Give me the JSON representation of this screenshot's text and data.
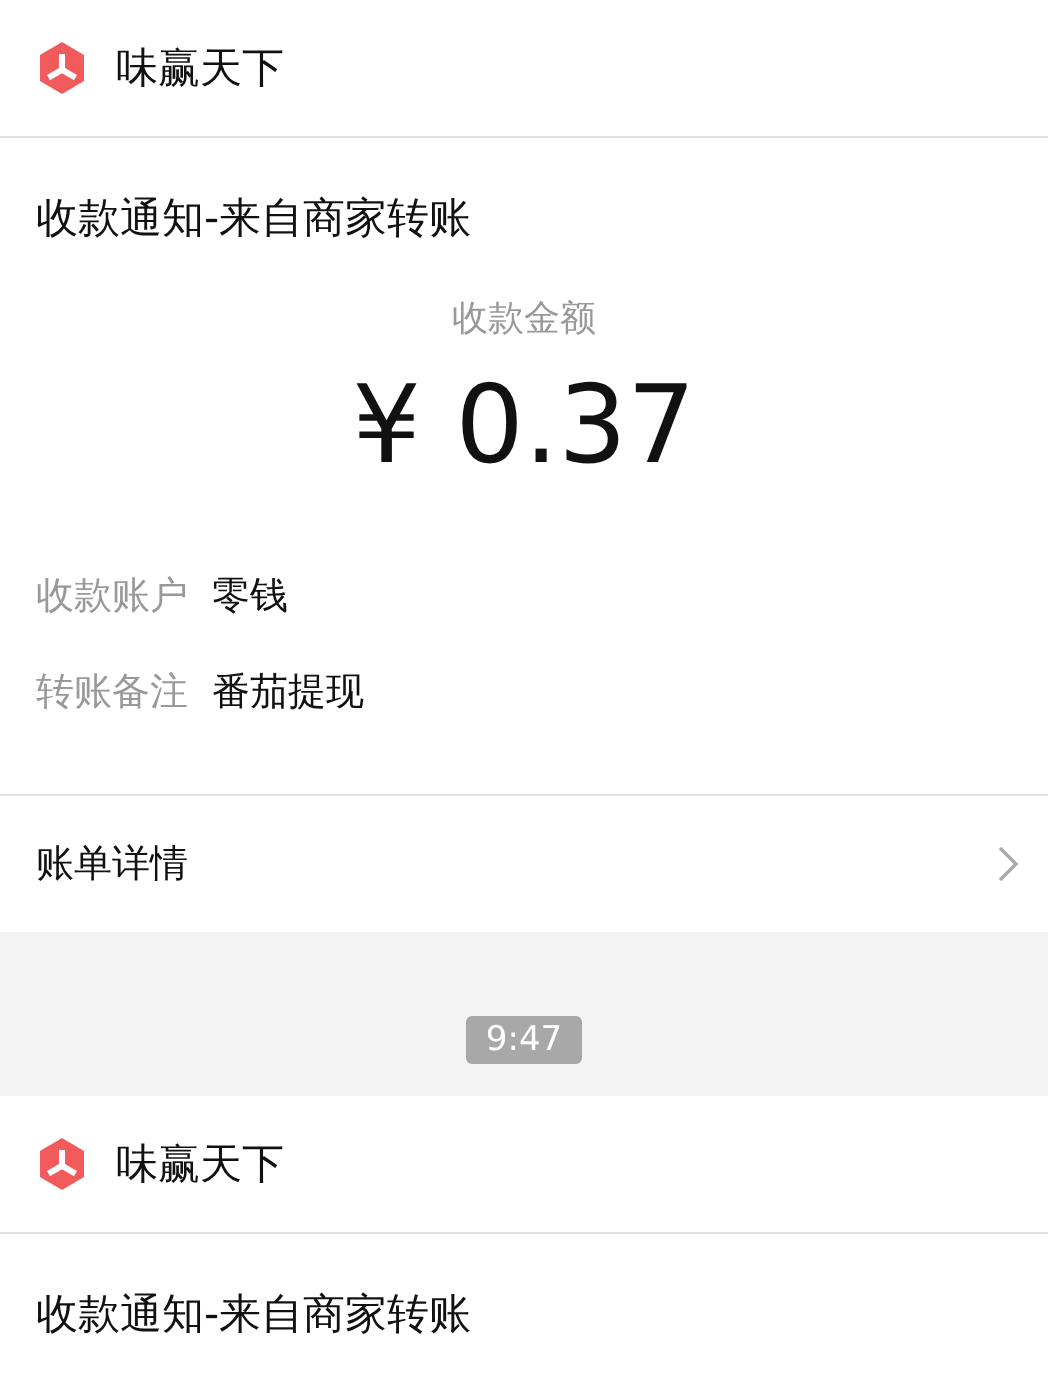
{
  "messages": [
    {
      "account_name": "味赢天下",
      "title": "收款通知-来自商家转账",
      "amount_label": "收款金额",
      "amount": "¥ 0.37",
      "fields": [
        {
          "label": "收款账户",
          "value": "零钱"
        },
        {
          "label": "转账备注",
          "value": "番茄提现"
        }
      ],
      "details_link": "账单详情"
    },
    {
      "account_name": "味赢天下",
      "title": "收款通知-来自商家转账"
    }
  ],
  "timestamp": "9:47"
}
